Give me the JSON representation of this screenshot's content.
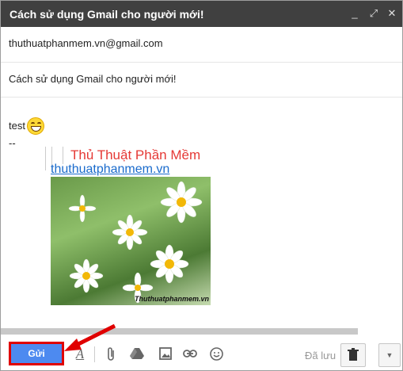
{
  "window": {
    "title": "Cách sử dụng Gmail cho người mới!",
    "controls": [
      {
        "name": "minimize-icon",
        "glyph": "_"
      },
      {
        "name": "expand-icon",
        "glyph": "⤢"
      },
      {
        "name": "close-icon",
        "glyph": "✕"
      }
    ]
  },
  "compose": {
    "to": "thuthuatphanmem.vn@gmail.com",
    "subject": "Cách sử dụng Gmail cho người mới!",
    "body_text": "test",
    "body_emoji": "grinning-face-icon",
    "signature_separator": "--",
    "signature": {
      "title": "Thủ Thuật Phần Mềm",
      "link": "thuthuatphanmem.vn",
      "image_watermark": "Thuthuatphanmem.vn"
    }
  },
  "toolbar": {
    "send_label": "Gửi",
    "saved_label": "Đã lưu",
    "icons": [
      "text-format-icon",
      "attach-icon",
      "drive-icon",
      "photo-icon",
      "link-icon",
      "emoji-icon"
    ],
    "trash_icon": "trash-icon",
    "more_icon": "chevron-down-icon"
  },
  "colors": {
    "titlebar": "#404040",
    "send_button": "#4d8af0",
    "highlight": "#e00000",
    "signature_title": "#e53935",
    "signature_link": "#1a6bcc"
  }
}
